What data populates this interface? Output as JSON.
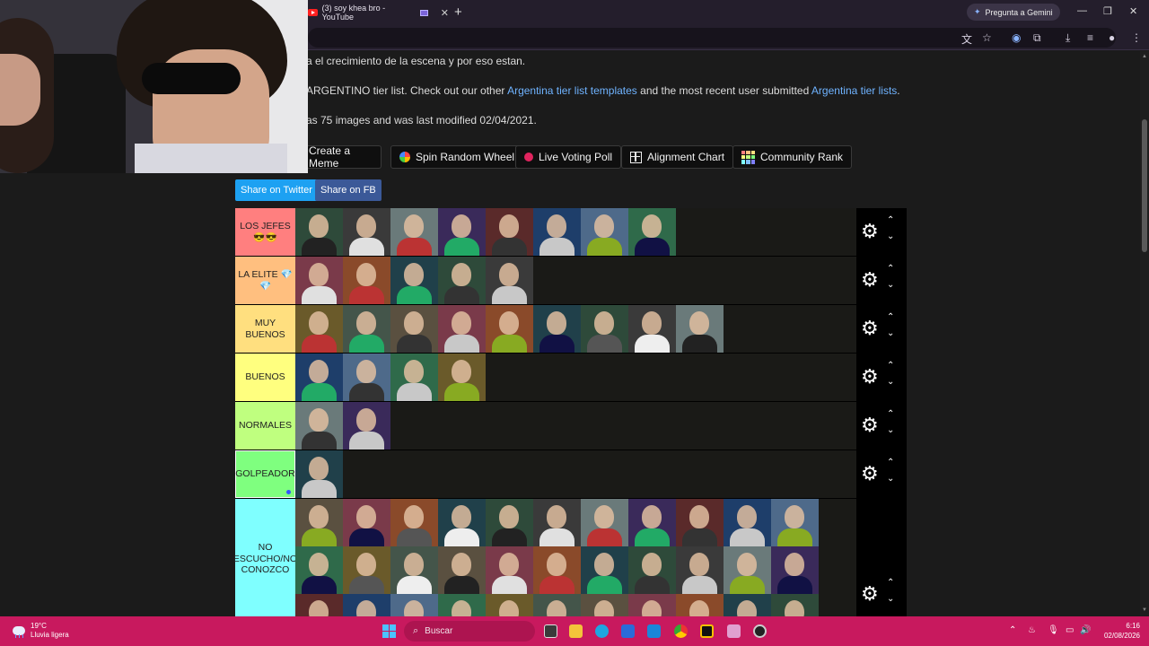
{
  "browser": {
    "tab_title": "(3) soy khea bro - YouTube",
    "tab_close": "✕",
    "new_tab": "+",
    "gemini_label": "Pregunta a Gemini",
    "window_controls": [
      "—",
      "❐",
      "✕"
    ]
  },
  "page": {
    "desc_line1": "a el crecimiento de la escena y por eso estan.",
    "desc_line2_pre": "ARGENTINO tier list. Check out our other ",
    "desc_line2_link1": "Argentina tier list templates",
    "desc_line2_mid": " and the most recent user submitted ",
    "desc_line2_link2": "Argentina tier lists",
    "desc_line2_post": ".",
    "desc_line3": "as 75 images and was last modified 02/04/2021.",
    "buttons": {
      "meme": "Create a Meme",
      "wheel": "Spin Random Wheel",
      "poll": "Live Voting Poll",
      "alignment": "Alignment Chart",
      "community": "Community Rank"
    },
    "share_twitter": "Share on Twitter",
    "share_fb": "Share on FB"
  },
  "tiers": [
    {
      "label": "LOS JEFES 😎😎",
      "color": "#ff7f7f",
      "count": 8
    },
    {
      "label": "LA ELITE 💎💎",
      "color": "#ffbf7f",
      "count": 5
    },
    {
      "label": "MUY BUENOS",
      "color": "#ffdf7f",
      "count": 9
    },
    {
      "label": "BUENOS",
      "color": "#ffff7f",
      "count": 4
    },
    {
      "label": "NORMALES",
      "color": "#bfff7f",
      "count": 2
    },
    {
      "label": "GOLPEADOR",
      "color": "#7fff7f",
      "count": 1
    },
    {
      "label": "NO ESCUCHO/NO CONOZCO",
      "color": "#7fffff",
      "count": 33
    }
  ],
  "tier_controls": {
    "gear": "⚙",
    "up": "⌃",
    "down": "⌄"
  },
  "taskbar": {
    "temp": "19°C",
    "weather": "Lluvia ligera",
    "search": "Buscar",
    "time": "6:16",
    "date": "02/08/2026"
  }
}
